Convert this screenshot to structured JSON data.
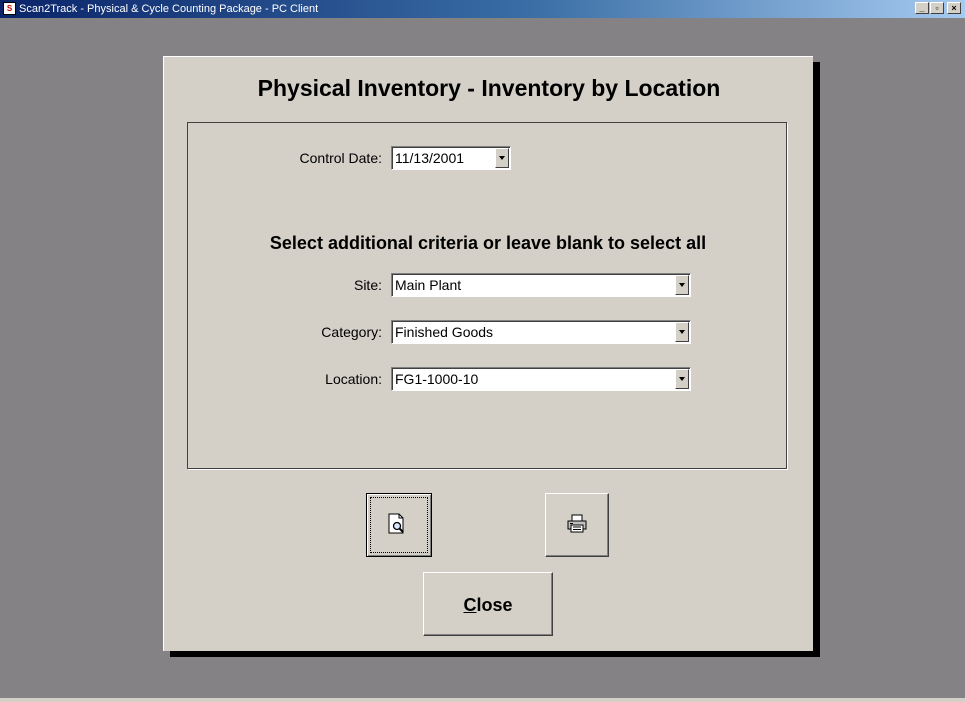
{
  "window": {
    "title": "Scan2Track - Physical & Cycle Counting Package - PC Client",
    "app_icon_text": "S",
    "minimize_glyph": "_",
    "restore_glyph": "▫",
    "close_glyph": "×"
  },
  "dialog": {
    "title": "Physical Inventory - Inventory by Location",
    "subtitle": "Select additional criteria or leave blank to select all",
    "control_date": {
      "label": "Control Date:",
      "value": "11/13/2001"
    },
    "site": {
      "label": "Site:",
      "value": "Main Plant"
    },
    "category": {
      "label": "Category:",
      "value": "Finished Goods"
    },
    "location": {
      "label": "Location:",
      "value": "FG1-1000-10"
    },
    "buttons": {
      "preview_icon": "print-preview-icon",
      "print_icon": "printer-icon",
      "close_label_accel": "C",
      "close_label_rest": "lose"
    }
  }
}
